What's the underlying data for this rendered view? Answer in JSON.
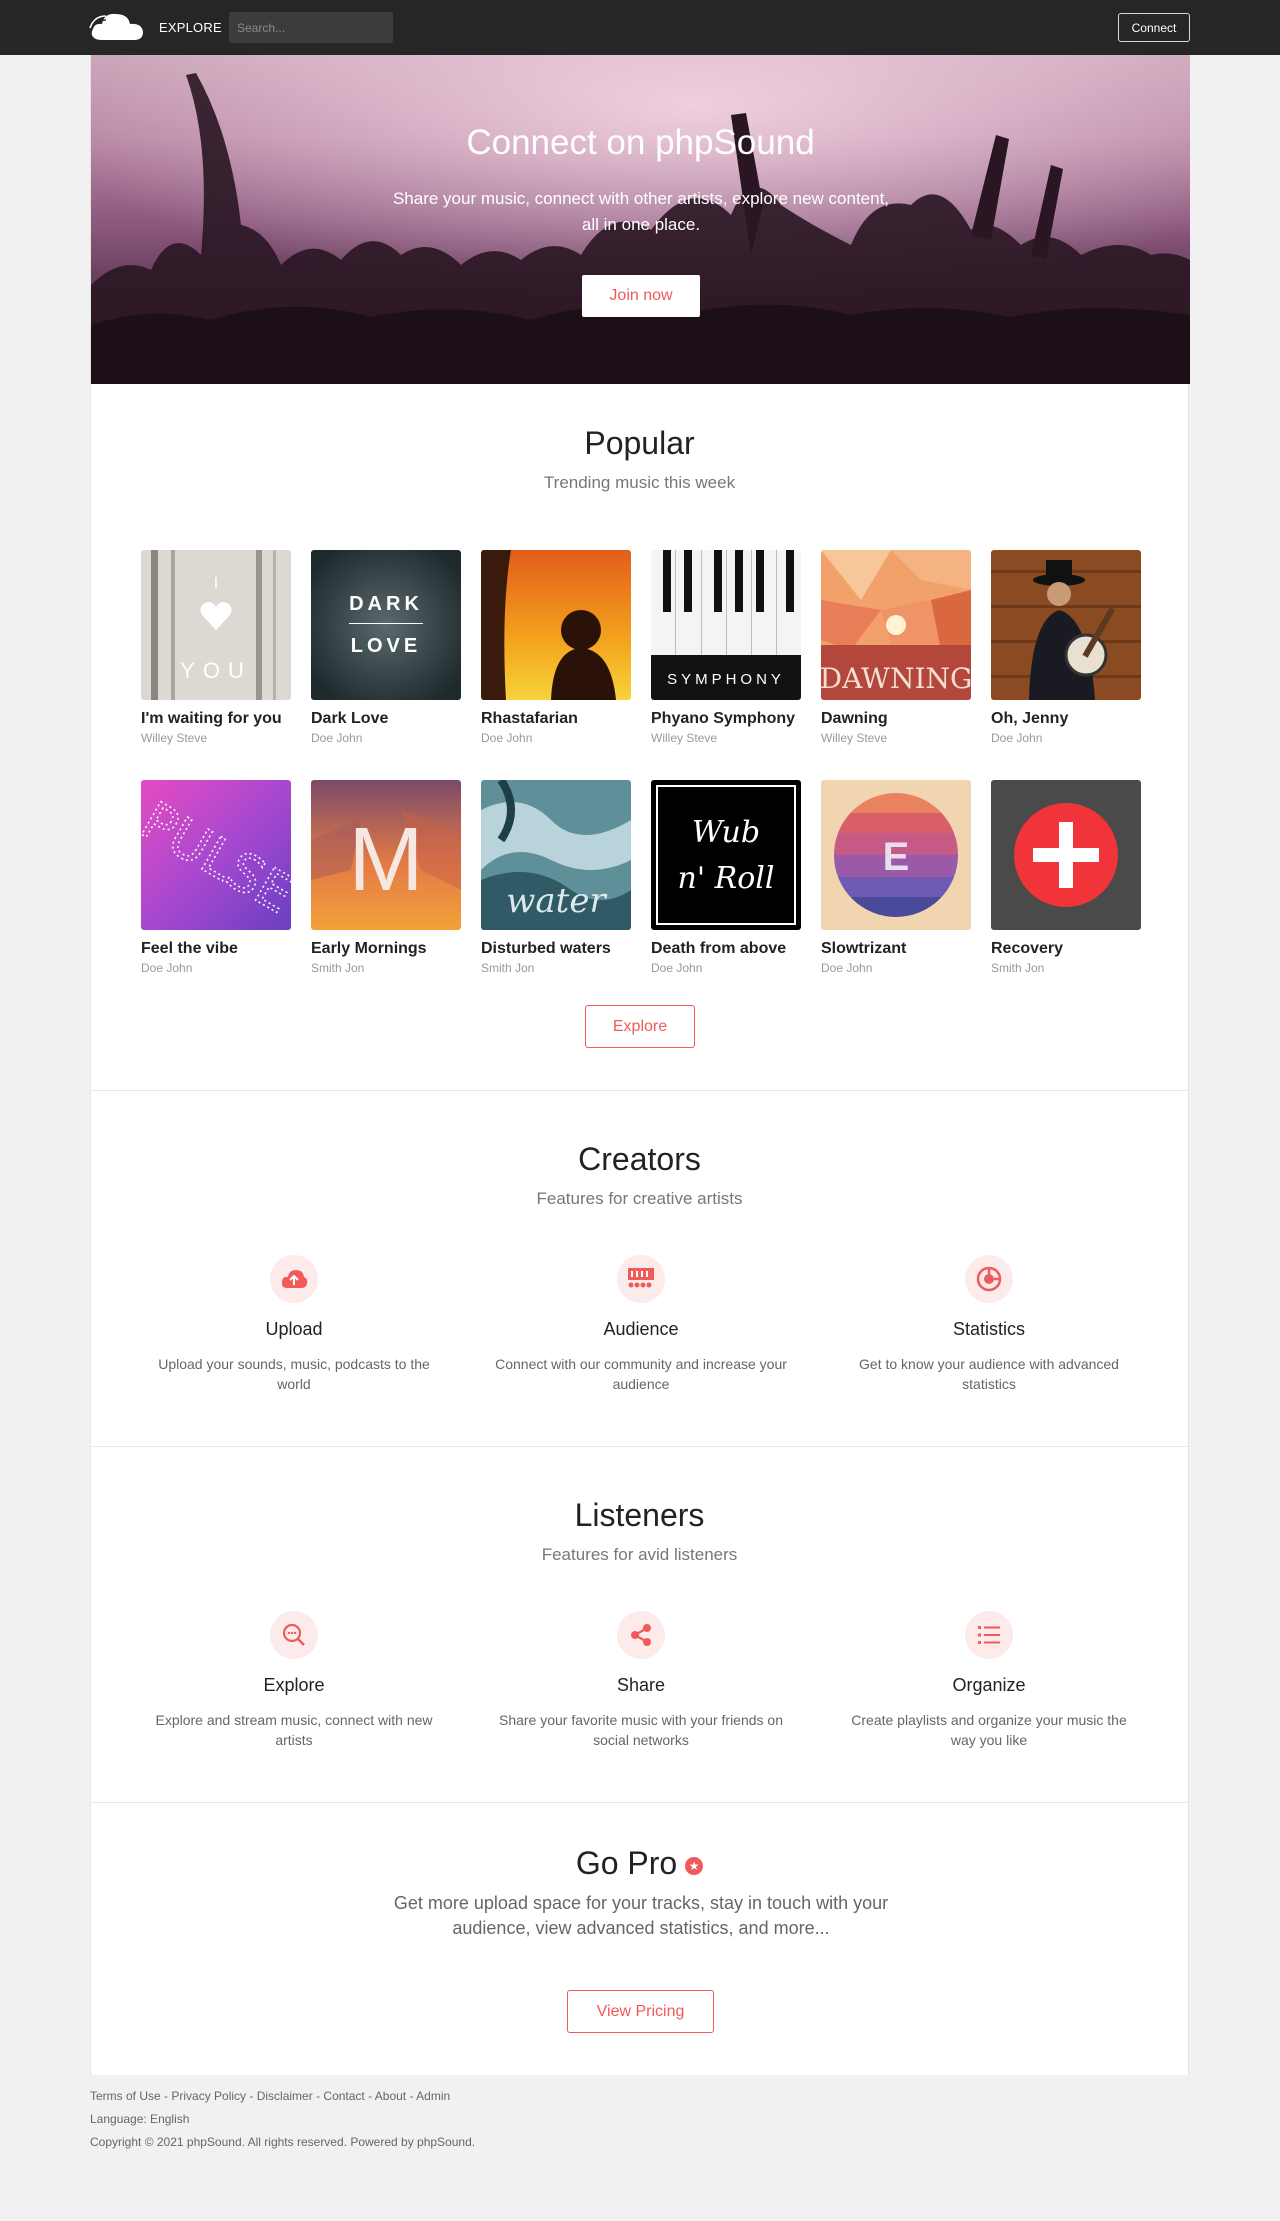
{
  "header": {
    "nav_explore": "EXPLORE",
    "search_placeholder": "Search...",
    "connect_label": "Connect"
  },
  "hero": {
    "title": "Connect on phpSound",
    "subtitle": "Share your music, connect with other artists, explore new content, all in one place.",
    "cta_label": "Join now"
  },
  "popular": {
    "title": "Popular",
    "subtitle": "Trending music this week",
    "explore_label": "Explore",
    "tracks": [
      {
        "title": "I'm waiting for you",
        "artist": "Willey Steve",
        "art_text": [
          "I",
          "YOU"
        ]
      },
      {
        "title": "Dark Love",
        "artist": "Doe John",
        "art_text": [
          "DARK",
          "LOVE"
        ]
      },
      {
        "title": "Rhastafarian",
        "artist": "Doe John"
      },
      {
        "title": "Phyano Symphony",
        "artist": "Willey Steve",
        "art_text": [
          "SYMPHONY"
        ]
      },
      {
        "title": "Dawning",
        "artist": "Willey Steve",
        "art_text": [
          "DAWNING"
        ]
      },
      {
        "title": "Oh, Jenny",
        "artist": "Doe John"
      },
      {
        "title": "Feel the vibe",
        "artist": "Doe John",
        "art_text": [
          "PULSE"
        ]
      },
      {
        "title": "Early Mornings",
        "artist": "Smith Jon",
        "art_text": [
          "M"
        ]
      },
      {
        "title": "Disturbed waters",
        "artist": "Smith Jon",
        "art_text": [
          "water"
        ]
      },
      {
        "title": "Death from above",
        "artist": "Doe John",
        "art_text": [
          "Wub",
          "n' Roll"
        ]
      },
      {
        "title": "Slowtrizant",
        "artist": "Doe John",
        "art_text": [
          "E"
        ]
      },
      {
        "title": "Recovery",
        "artist": "Smith Jon"
      }
    ]
  },
  "creators": {
    "title": "Creators",
    "subtitle": "Features for creative artists",
    "features": [
      {
        "icon": "cloud-upload-icon",
        "title": "Upload",
        "desc": "Upload your sounds, music, podcasts to the world"
      },
      {
        "icon": "audience-icon",
        "title": "Audience",
        "desc": "Connect with our community and increase your audience"
      },
      {
        "icon": "statistics-icon",
        "title": "Statistics",
        "desc": "Get to know your audience with advanced statistics"
      }
    ]
  },
  "listeners": {
    "title": "Listeners",
    "subtitle": "Features for avid listeners",
    "features": [
      {
        "icon": "search-icon",
        "title": "Explore",
        "desc": "Explore and stream music, connect with new artists"
      },
      {
        "icon": "share-icon",
        "title": "Share",
        "desc": "Share your favorite music with your friends on social networks"
      },
      {
        "icon": "list-icon",
        "title": "Organize",
        "desc": "Create playlists and organize your music the way you like"
      }
    ]
  },
  "pro": {
    "title": "Go Pro",
    "desc": "Get more upload space for your tracks, stay in touch with your audience, view advanced statistics, and more...",
    "cta_label": "View Pricing"
  },
  "footer": {
    "links": [
      "Terms of Use",
      "Privacy Policy",
      "Disclaimer",
      "Contact",
      "About",
      "Admin"
    ],
    "language": "Language: English",
    "copyright": "Copyright © 2021 phpSound. All rights reserved. Powered by phpSound."
  },
  "colors": {
    "accent": "#f05a5a",
    "topbar": "#262626"
  }
}
